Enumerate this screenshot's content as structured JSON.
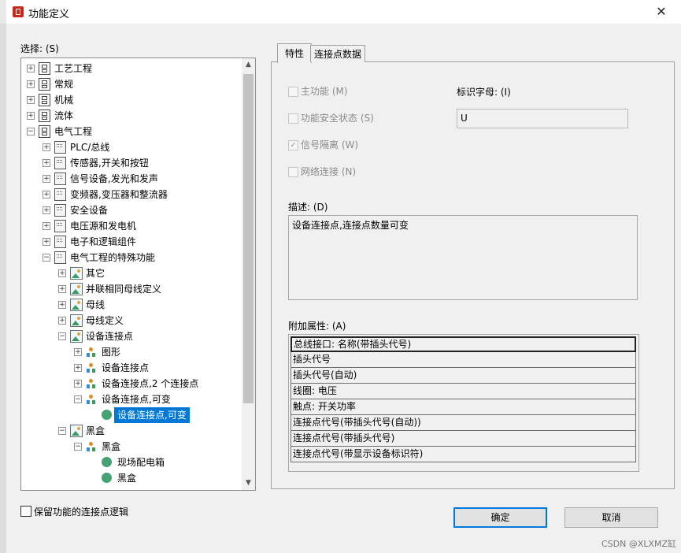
{
  "window": {
    "title": "功能定义",
    "close_glyph": "✕",
    "accent": "#c42b1c"
  },
  "select_label": "选择: (S)",
  "tree": {
    "items": [
      {
        "label": "工艺工程",
        "icon": "box-icon",
        "expander": "+"
      },
      {
        "label": "常规",
        "icon": "box-icon",
        "expander": "+"
      },
      {
        "label": "机械",
        "icon": "box-icon",
        "expander": "+"
      },
      {
        "label": "流体",
        "icon": "box-icon",
        "expander": "+"
      },
      {
        "label": "电气工程",
        "icon": "box-icon",
        "expander": "−"
      },
      {
        "label": "PLC/总线",
        "icon": "module-icon",
        "expander": "+"
      },
      {
        "label": "传感器,开关和按钮",
        "icon": "module-icon",
        "expander": "+"
      },
      {
        "label": "信号设备,发光和发声",
        "icon": "module-icon",
        "expander": "+"
      },
      {
        "label": "变频器,变压器和整流器",
        "icon": "module-icon",
        "expander": "+"
      },
      {
        "label": "安全设备",
        "icon": "module-icon",
        "expander": "+"
      },
      {
        "label": "电压源和发电机",
        "icon": "module-icon",
        "expander": "+"
      },
      {
        "label": "电子和逻辑组件",
        "icon": "module-icon",
        "expander": "+"
      },
      {
        "label": "电气工程的特殊功能",
        "icon": "module-icon",
        "expander": "−"
      },
      {
        "label": "其它",
        "icon": "picture-icon",
        "expander": "+"
      },
      {
        "label": "并联相同母线定义",
        "icon": "picture-icon",
        "expander": "+"
      },
      {
        "label": "母线",
        "icon": "picture-icon",
        "expander": "+"
      },
      {
        "label": "母线定义",
        "icon": "picture-icon",
        "expander": "+"
      },
      {
        "label": "设备连接点",
        "icon": "picture-icon",
        "expander": "−"
      },
      {
        "label": "图形",
        "icon": "symbol-icon",
        "expander": "+"
      },
      {
        "label": "设备连接点",
        "icon": "symbol-icon",
        "expander": "+"
      },
      {
        "label": "设备连接点,2 个连接点",
        "icon": "symbol-icon",
        "expander": "+"
      },
      {
        "label": "设备连接点,可变",
        "icon": "symbol-icon",
        "expander": "−"
      },
      {
        "label": "设备连接点,可变",
        "icon": "function-icon",
        "expander": ""
      },
      {
        "label": "黑盒",
        "icon": "picture-icon",
        "expander": "−"
      },
      {
        "label": "黑盒",
        "icon": "symbol-icon",
        "expander": "−"
      },
      {
        "label": "现场配电箱",
        "icon": "function-icon",
        "expander": ""
      },
      {
        "label": "黑盒",
        "icon": "function-icon",
        "expander": ""
      }
    ],
    "selected_index": 22
  },
  "keep_logic_label": "保留功能的连接点逻辑",
  "tabs": {
    "properties": "特性",
    "connection_data": "连接点数据"
  },
  "checkboxes": {
    "main_function": {
      "label": "主功能 (M)",
      "checked": false
    },
    "safety_state": {
      "label": "功能安全状态 (S)",
      "checked": false
    },
    "signal_isolation": {
      "label": "信号隔离 (W)",
      "checked": true
    },
    "network_connection": {
      "label": "网络连接 (N)",
      "checked": false
    }
  },
  "identifier": {
    "label": "标识字母: (I)",
    "value": "U"
  },
  "description": {
    "label": "描述: (D)",
    "value": "设备连接点,连接点数量可变"
  },
  "additional": {
    "label": "附加属性: (A)",
    "rows": [
      "总线接口: 名称(带插头代号)",
      "插头代号",
      "插头代号(自动)",
      "线圈: 电压",
      "触点: 开关功率",
      "连接点代号(带插头代号(自动))",
      "连接点代号(带插头代号)",
      "连接点代号(带显示设备标识符)"
    ]
  },
  "buttons": {
    "ok": "确定",
    "cancel": "取消",
    "accent": "#0078d7"
  },
  "watermark": "CSDN @XLXMZ缸"
}
